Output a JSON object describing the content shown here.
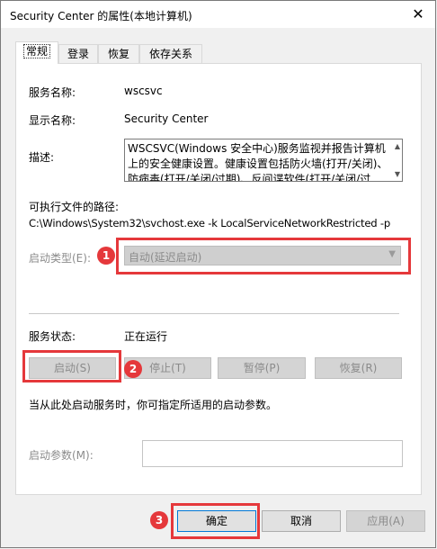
{
  "window": {
    "title": "Security Center 的属性(本地计算机)",
    "close_icon": "✕"
  },
  "tabs": [
    {
      "label": "常规",
      "active": true
    },
    {
      "label": "登录"
    },
    {
      "label": "恢复"
    },
    {
      "label": "依存关系"
    }
  ],
  "general": {
    "service_name_label": "服务名称:",
    "service_name_value": "wscsvc",
    "display_name_label": "显示名称:",
    "display_name_value": "Security Center",
    "description_label": "描述:",
    "description_value": "WSCSVC(Windows 安全中心)服务监视并报告计算机上的安全健康设置。健康设置包括防火墙(打开/关闭)、防病毒(打开/关闭/过期)、反间谍软件(打开/关闭/过",
    "path_label": "可执行文件的路径:",
    "path_value": "C:\\Windows\\System32\\svchost.exe -k LocalServiceNetworkRestricted -p",
    "startup_type_label": "启动类型(E):",
    "startup_type_value": "自动(延迟启动)",
    "service_status_label": "服务状态:",
    "service_status_value": "正在运行",
    "hint_text": "当从此处启动服务时，你可指定所适用的启动参数。",
    "start_params_label": "启动参数(M):",
    "start_params_value": ""
  },
  "service_buttons": {
    "start": "启动(S)",
    "stop": "停止(T)",
    "pause": "暂停(P)",
    "resume": "恢复(R)"
  },
  "dialog_buttons": {
    "ok": "确定",
    "cancel": "取消",
    "apply": "应用(A)"
  },
  "annotations": {
    "badge1": "1",
    "badge2": "2",
    "badge3": "3",
    "highlight_color": "#e5383b"
  },
  "colors": {
    "accent": "#0078d7",
    "disabled_text": "#8b8b8b"
  }
}
